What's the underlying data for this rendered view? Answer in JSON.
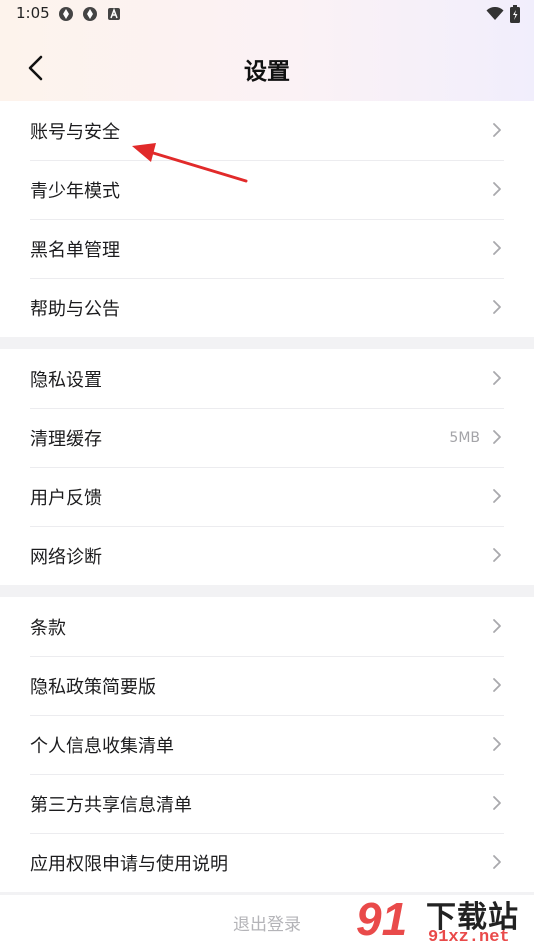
{
  "status_bar": {
    "time": "1:05"
  },
  "header": {
    "title": "设置"
  },
  "groups": [
    {
      "items": [
        {
          "label": "账号与安全"
        },
        {
          "label": "青少年模式"
        },
        {
          "label": "黑名单管理"
        },
        {
          "label": "帮助与公告"
        }
      ]
    },
    {
      "items": [
        {
          "label": "隐私设置"
        },
        {
          "label": "清理缓存",
          "value": "5MB"
        },
        {
          "label": "用户反馈"
        },
        {
          "label": "网络诊断"
        }
      ]
    },
    {
      "items": [
        {
          "label": "条款"
        },
        {
          "label": "隐私政策简要版"
        },
        {
          "label": "个人信息收集清单"
        },
        {
          "label": "第三方共享信息清单"
        },
        {
          "label": "应用权限申请与使用说明"
        }
      ]
    }
  ],
  "logout": {
    "label": "退出登录"
  },
  "watermark": {
    "number": "91",
    "text": "下载站",
    "url": "91xz.net"
  },
  "colors": {
    "annotation_arrow": "#e12a2a",
    "watermark_red": "#e94a4a"
  }
}
